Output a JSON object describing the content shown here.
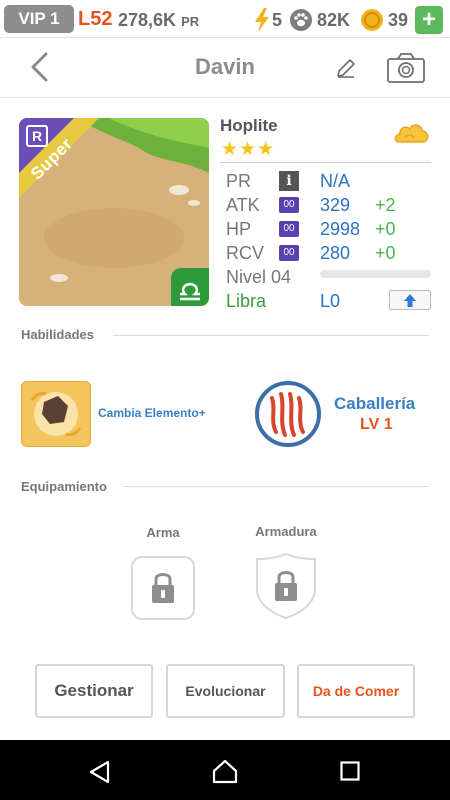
{
  "status": {
    "vip": "VIP 1",
    "level": "L52",
    "pr_value": "278,6K",
    "pr_unit": "PR",
    "energy": "5",
    "paw": "82K",
    "coins": "39",
    "plus": "+"
  },
  "header": {
    "title": "Davin"
  },
  "card": {
    "rarity": "R",
    "tier": "Super"
  },
  "unit": {
    "name": "Hoplite",
    "stars": "★★★",
    "stats": [
      {
        "label": "PR",
        "value": "N/A",
        "bonus": "",
        "badge": "i"
      },
      {
        "label": "ATK",
        "value": "329",
        "bonus": "+2",
        "badge": "00"
      },
      {
        "label": "HP",
        "value": "2998",
        "bonus": "+0",
        "badge": "00"
      },
      {
        "label": "RCV",
        "value": "280",
        "bonus": "+0",
        "badge": "00"
      }
    ],
    "level_label": "Nivel 04",
    "level_progress": 0,
    "sign_label": "Libra",
    "sign_value": "L0"
  },
  "skills": {
    "section": "Habilidades",
    "active_name": "Cambia Elemento+",
    "passive_name": "Caballería",
    "passive_level": "LV 1"
  },
  "equipment": {
    "section": "Equipamiento",
    "weapon": "Arma",
    "armor": "Armadura"
  },
  "buttons": {
    "manage": "Gestionar",
    "evolve": "Evolucionar",
    "feed": "Da de Comer"
  },
  "colors": {
    "accent_blue": "#2a73c2",
    "accent_orange": "#e8531a",
    "bonus_green": "#4cb34c",
    "star_gold": "#f5c516"
  }
}
